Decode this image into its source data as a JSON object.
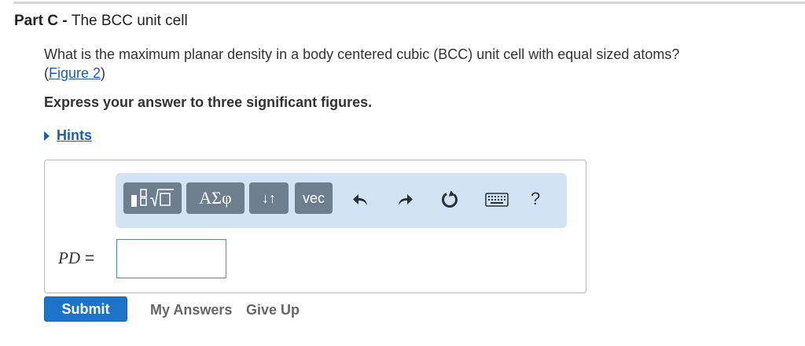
{
  "part": {
    "label": "Part C",
    "separator": " - ",
    "title": "The BCC unit cell"
  },
  "question": {
    "text": "What is the maximum planar density in a body centered cubic (BCC) unit cell with equal sized atoms?",
    "figure_open": "(",
    "figure_link": "Figure 2",
    "figure_close": ")"
  },
  "instruction": "Express your answer to three significant figures.",
  "hints": {
    "label": "Hints",
    "icon": "triangle-right-icon"
  },
  "toolbar": {
    "greek_label": "ΑΣφ",
    "arrows_label": "↓↑",
    "vec_label": "vec",
    "help_label": "?",
    "icons": [
      "templates-icon",
      "undo-icon",
      "redo-icon",
      "reset-icon",
      "keyboard-icon"
    ]
  },
  "answer": {
    "variable": "PD",
    "equals": " =",
    "value": "",
    "placeholder": ""
  },
  "actions": {
    "submit": "Submit",
    "my_answers": "My Answers",
    "give_up": "Give Up"
  },
  "colors": {
    "link": "#1a5fb4",
    "toolbar_bg": "#d3e3f6",
    "toolbar_button": "#6d7f8f",
    "submit_bg": "#1b74c8"
  }
}
